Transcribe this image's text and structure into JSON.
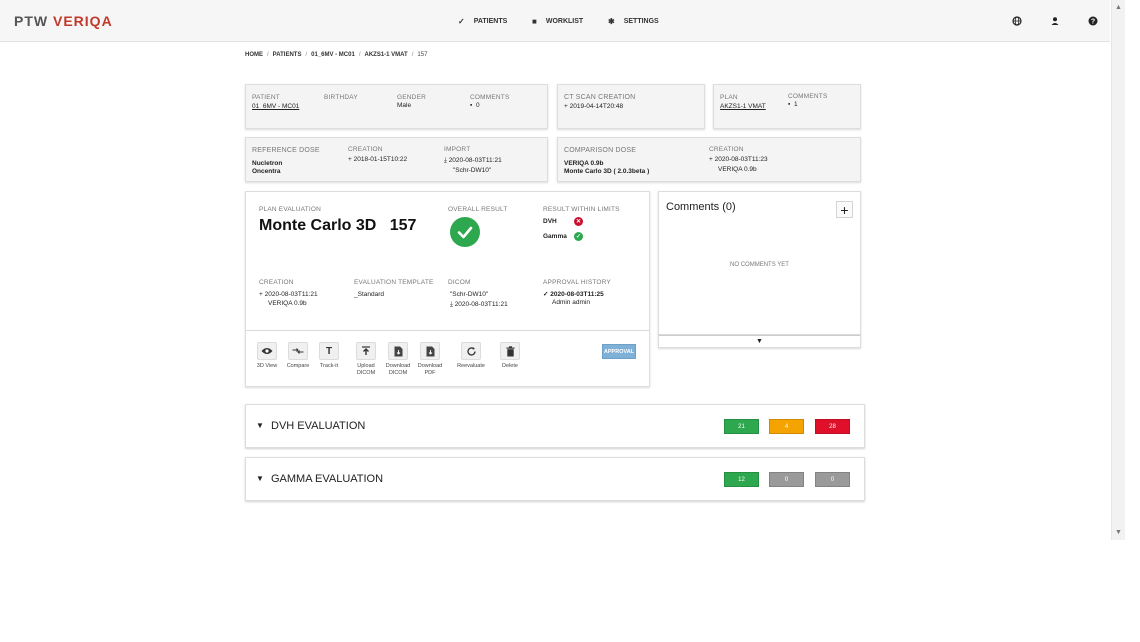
{
  "header": {
    "logo_left": "PTW",
    "logo_right": "VERIQA",
    "nav": [
      {
        "label": "PATIENTS",
        "icon": "check-icon"
      },
      {
        "label": "WORKLIST",
        "icon": "list-icon"
      },
      {
        "label": "SETTINGS",
        "icon": "gear-icon"
      }
    ],
    "right_icons": [
      "globe-icon",
      "user-icon",
      "help-icon"
    ]
  },
  "breadcrumb": [
    "HOME",
    "PATIENTS",
    "01_6MV - MC01",
    "AKZS1-1 VMAT",
    "157"
  ],
  "patient_card": {
    "patient_label": "PATIENT",
    "patient_value": "01_6MV - MC01",
    "birthday_label": "BIRTHDAY",
    "gender_label": "GENDER",
    "gender_value": "Male",
    "comments_label": "COMMENTS",
    "comments_value": "0"
  },
  "ct_card": {
    "label": "CT SCAN CREATION",
    "value": "2019-04-14T20:48"
  },
  "plan_card": {
    "plan_label": "PLAN",
    "plan_value": "AKZS1-1 VMAT",
    "comments_label": "COMMENTS",
    "comments_value": "1"
  },
  "reference_card": {
    "label": "REFERENCE DOSE",
    "line1": "Nucletron",
    "line2": "Oncentra",
    "creation_label": "CREATION",
    "creation_value": "2018-01-15T10:22",
    "import_label": "IMPORT",
    "import_value": "2020-08-03T11:21",
    "import_sub": "\"Schr-DW10\""
  },
  "comparison_card": {
    "label": "COMPARISON DOSE",
    "line1": "VERIQA 0.9b",
    "line2": "Monte Carlo 3D ( 2.0.3beta )",
    "creation_label": "CREATION",
    "creation_value": "2020-08-03T11:23",
    "creation_sub": "VERIQA 0.9b"
  },
  "plan_eval": {
    "label": "PLAN EVALUATION",
    "title": "Monte Carlo 3D",
    "number": "157",
    "overall_label": "OVERALL RESULT",
    "limits_label": "RESULT WITHIN LIMITS",
    "limits": [
      {
        "name": "DVH",
        "status": "fail"
      },
      {
        "name": "Gamma",
        "status": "pass"
      }
    ],
    "creation_label": "CREATION",
    "creation_value": "2020-08-03T11:21",
    "creation_sub": "VERIQA 0.9b",
    "template_label": "EVALUATION TEMPLATE",
    "template_value": "_Standard",
    "dicom_label": "DICOM",
    "dicom_value": "\"Schr-DW10\"",
    "dicom_sub": "2020-08-03T11:21",
    "approval_label": "APPROVAL HISTORY",
    "approval_value": "2020-08-03T11:25",
    "approval_sub": "Admin admin"
  },
  "toolbar": {
    "tools": [
      {
        "label1": "3D View",
        "label2": "",
        "icon": "eye-icon"
      },
      {
        "label1": "Compare",
        "label2": "",
        "icon": "compare-icon"
      },
      {
        "label1": "Track-it",
        "label2": "",
        "icon": "trackit-icon"
      },
      {
        "label1": "Upload",
        "label2": "DICOM",
        "icon": "upload-icon"
      },
      {
        "label1": "Download",
        "label2": "DICOM",
        "icon": "download-dicom-icon"
      },
      {
        "label1": "Download",
        "label2": "PDF",
        "icon": "download-pdf-icon"
      },
      {
        "label1": "Reevaluate",
        "label2": "",
        "icon": "refresh-icon"
      },
      {
        "label1": "Delete",
        "label2": "",
        "icon": "trash-icon"
      }
    ],
    "approval_label": "APPROVAL"
  },
  "comments": {
    "title": "Comments (0)",
    "empty": "NO COMMENTS YET"
  },
  "dvh_eval": {
    "title": "DVH EVALUATION",
    "counts": [
      "21",
      "4",
      "28"
    ],
    "colors": [
      "#2ea84f",
      "#f4a300",
      "#e0102b"
    ]
  },
  "gamma_eval": {
    "title": "GAMMA EVALUATION",
    "counts": [
      "12",
      "0",
      "0"
    ],
    "colors": [
      "#2ea84f",
      "#9a9a9a",
      "#9a9a9a"
    ]
  }
}
